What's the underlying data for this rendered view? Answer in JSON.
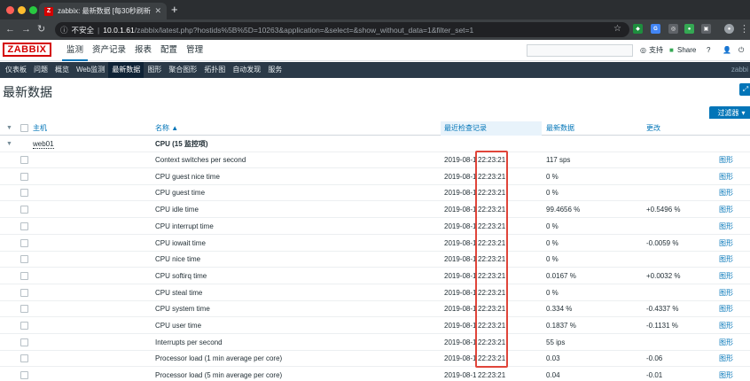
{
  "browser": {
    "tab_title": "zabbix: 最新数据 [每30秒刷新一次]",
    "favicon": "Z",
    "url_insecure_label": "不安全",
    "url_host": "10.0.1.61",
    "url_path": "/zabbix/latest.php?hostids%5B%5D=10263&application=&select=&show_without_data=1&filter_set=1"
  },
  "header": {
    "logo": "ZABBIX",
    "menu": [
      "监测",
      "资产记录",
      "报表",
      "配置",
      "管理"
    ],
    "support": "支持",
    "share": "Share",
    "help": "?",
    "user_icon": "person-icon",
    "logout_icon": "power-icon"
  },
  "submenu": {
    "items": [
      "仪表板",
      "问题",
      "概览",
      "Web监测",
      "最新数据",
      "图形",
      "聚合图形",
      "拓扑图",
      "自动发现",
      "服务"
    ],
    "right": "zabbi"
  },
  "page": {
    "title": "最新数据",
    "filter_tab": "过滤器"
  },
  "table": {
    "headers": {
      "host": "主机",
      "name": "名称 ▲",
      "last_check": "最近检查记录",
      "last_value": "最新数据",
      "change": "更改"
    },
    "host": "web01",
    "group": "CPU (15 监控项)",
    "rows": [
      {
        "name": "Context switches per second",
        "date": "2019-08-1",
        "time": "22:23:21",
        "value": "117 sps",
        "change": "",
        "graph": "图形"
      },
      {
        "name": "CPU guest nice time",
        "date": "2019-08-1",
        "time": "22:23:21",
        "value": "0 %",
        "change": "",
        "graph": "图形"
      },
      {
        "name": "CPU guest time",
        "date": "2019-08-1",
        "time": "22:23:21",
        "value": "0 %",
        "change": "",
        "graph": "图形"
      },
      {
        "name": "CPU idle time",
        "date": "2019-08-1",
        "time": "22:23:21",
        "value": "99.4656 %",
        "change": "+0.5496 %",
        "graph": "图形"
      },
      {
        "name": "CPU interrupt time",
        "date": "2019-08-1",
        "time": "22:23:21",
        "value": "0 %",
        "change": "",
        "graph": "图形"
      },
      {
        "name": "CPU iowait time",
        "date": "2019-08-1",
        "time": "22:23:21",
        "value": "0 %",
        "change": "-0.0059 %",
        "graph": "图形"
      },
      {
        "name": "CPU nice time",
        "date": "2019-08-1",
        "time": "22:23:21",
        "value": "0 %",
        "change": "",
        "graph": "图形"
      },
      {
        "name": "CPU softirq time",
        "date": "2019-08-1",
        "time": "22:23:21",
        "value": "0.0167 %",
        "change": "+0.0032 %",
        "graph": "图形"
      },
      {
        "name": "CPU steal time",
        "date": "2019-08-1",
        "time": "22:23:21",
        "value": "0 %",
        "change": "",
        "graph": "图形"
      },
      {
        "name": "CPU system time",
        "date": "2019-08-1",
        "time": "22:23:21",
        "value": "0.334 %",
        "change": "-0.4337 %",
        "graph": "图形"
      },
      {
        "name": "CPU user time",
        "date": "2019-08-1",
        "time": "22:23:21",
        "value": "0.1837 %",
        "change": "-0.1131 %",
        "graph": "图形"
      },
      {
        "name": "Interrupts per second",
        "date": "2019-08-1",
        "time": "22:23:21",
        "value": "55 ips",
        "change": "",
        "graph": "图形"
      },
      {
        "name": "Processor load (1 min average per core)",
        "date": "2019-08-1",
        "time": "22:23:21",
        "value": "0.03",
        "change": "-0.06",
        "graph": "图形"
      },
      {
        "name": "Processor load (5 min average per core)",
        "date": "2019-08-1",
        "time": "22:23:21",
        "value": "0.04",
        "change": "-0.01",
        "graph": "图形"
      }
    ]
  },
  "colors": {
    "accent": "#0275b8",
    "highlight_box": "#e0453a",
    "submenu_bg": "#2b3a48",
    "logo": "#d40000"
  }
}
